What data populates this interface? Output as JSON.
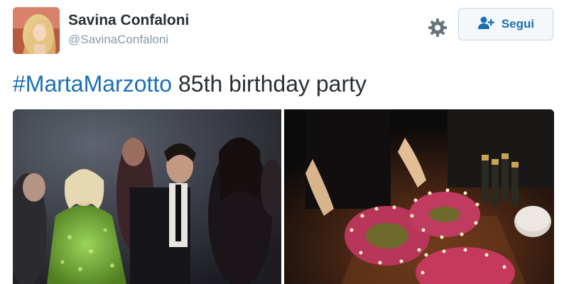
{
  "user": {
    "display_name": "Savina Confaloni",
    "handle": "@SavinaConfaloni",
    "avatar": "profile-photo"
  },
  "actions": {
    "settings_icon": "gear-icon",
    "follow_icon": "add-user-icon",
    "follow_label": "Segui"
  },
  "tweet": {
    "hashtag": "#MartaMarzotto",
    "text": " 85th birthday party"
  },
  "media": {
    "photos": [
      "party-crowd-photo",
      "birthday-cake-photo"
    ]
  },
  "colors": {
    "link": "#1b6fb5",
    "text": "#292f33",
    "muted": "#8899a6",
    "button_bg": "#f5f8fa",
    "button_border": "#c8d3dc"
  }
}
